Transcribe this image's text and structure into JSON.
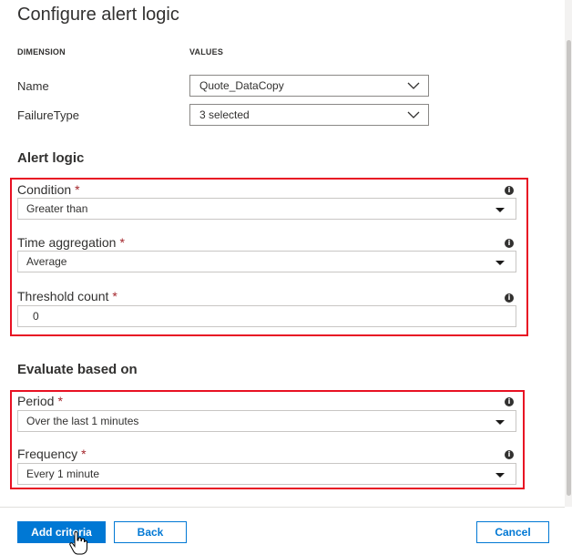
{
  "panel": {
    "title": "Configure alert logic"
  },
  "dimensions": {
    "col_dimension": "DIMENSION",
    "col_values": "VALUES",
    "rows": [
      {
        "label": "Name",
        "value": "Quote_DataCopy"
      },
      {
        "label": "FailureType",
        "value": "3 selected"
      }
    ]
  },
  "alert_logic": {
    "heading": "Alert logic",
    "condition": {
      "label": "Condition",
      "required": "*",
      "value": "Greater than"
    },
    "time_aggregation": {
      "label": "Time aggregation",
      "required": "*",
      "value": "Average"
    },
    "threshold": {
      "label": "Threshold count",
      "required": "*",
      "value": "0"
    }
  },
  "evaluate": {
    "heading": "Evaluate based on",
    "period": {
      "label": "Period",
      "required": "*",
      "value": "Over the last 1 minutes"
    },
    "frequency": {
      "label": "Frequency",
      "required": "*",
      "value": "Every 1 minute"
    }
  },
  "info_glyph": "i",
  "footer": {
    "add_criteria": "Add criteria",
    "back": "Back",
    "cancel": "Cancel"
  },
  "colors": {
    "primary": "#0078d4",
    "highlight_border": "#e81123",
    "required": "#a4262c"
  },
  "icons": {
    "chevron": "chevron-down-icon",
    "caret": "caret-down-icon",
    "info": "info-icon",
    "cursor": "hand-pointer-icon"
  }
}
